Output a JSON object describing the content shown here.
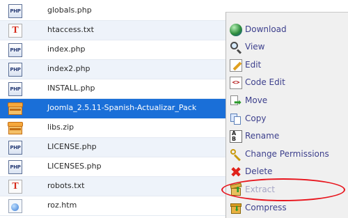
{
  "files": [
    {
      "name": "globals.php",
      "icon": "php-file-icon",
      "icon_text": "PHP"
    },
    {
      "name": "htaccess.txt",
      "icon": "text-file-icon",
      "icon_text": "T"
    },
    {
      "name": "index.php",
      "icon": "php-file-icon",
      "icon_text": "PHP"
    },
    {
      "name": "index2.php",
      "icon": "php-file-icon",
      "icon_text": "PHP"
    },
    {
      "name": "INSTALL.php",
      "icon": "php-file-icon",
      "icon_text": "PHP"
    },
    {
      "name": "Joomla_2.5.11-Spanish-Actualizar_Pack",
      "icon": "archive-file-icon",
      "icon_text": "",
      "selected": true
    },
    {
      "name": "libs.zip",
      "icon": "archive-file-icon",
      "icon_text": ""
    },
    {
      "name": "LICENSE.php",
      "icon": "php-file-icon",
      "icon_text": "PHP"
    },
    {
      "name": "LICENSES.php",
      "icon": "php-file-icon",
      "icon_text": "PHP"
    },
    {
      "name": "robots.txt",
      "icon": "text-file-icon",
      "icon_text": "T"
    },
    {
      "name": "roz.htm",
      "icon": "html-file-icon",
      "icon_text": ""
    }
  ],
  "row_markers": {
    "0": "<",
    "5": ">"
  },
  "context_menu": {
    "items": [
      {
        "label": "Download",
        "icon": "download-globe-icon",
        "enabled": true
      },
      {
        "label": "View",
        "icon": "magnifier-icon",
        "enabled": true
      },
      {
        "label": "Edit",
        "icon": "edit-pencil-icon",
        "enabled": true
      },
      {
        "label": "Code Edit",
        "icon": "code-edit-icon",
        "enabled": true,
        "icon_text": "<>"
      },
      {
        "label": "Move",
        "icon": "move-arrow-icon",
        "enabled": true
      },
      {
        "label": "Copy",
        "icon": "copy-icon",
        "enabled": true
      },
      {
        "label": "Rename",
        "icon": "rename-ab-icon",
        "enabled": true,
        "icon_text": "A B"
      },
      {
        "label": "Change Permissions",
        "icon": "key-icon",
        "enabled": true
      },
      {
        "label": "Delete",
        "icon": "delete-x-icon",
        "enabled": true,
        "icon_text": "✖"
      },
      {
        "label": "Extract",
        "icon": "extract-box-icon",
        "enabled": false
      },
      {
        "label": "Compress",
        "icon": "compress-box-icon",
        "enabled": true
      }
    ]
  },
  "colors": {
    "selected_row": "#1a6fd8",
    "menu_text": "#3c3f8c",
    "menu_text_disabled": "#a6a6c6",
    "annotation": "#e8141c"
  }
}
